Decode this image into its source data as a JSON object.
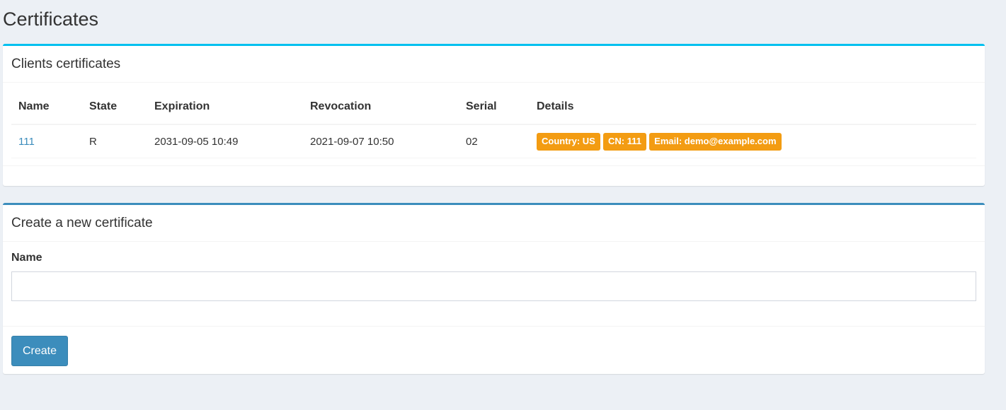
{
  "page": {
    "title": "Certificates"
  },
  "clients_box": {
    "title": "Clients certificates",
    "columns": [
      "Name",
      "State",
      "Expiration",
      "Revocation",
      "Serial",
      "Details"
    ],
    "rows": [
      {
        "name": "111",
        "state": "R",
        "expiration": "2031-09-05 10:49",
        "revocation": "2021-09-07 10:50",
        "serial": "02",
        "details": [
          "Country: US",
          "CN: 111",
          "Email: demo@example.com"
        ]
      }
    ]
  },
  "create_box": {
    "title": "Create a new certificate",
    "name_label": "Name",
    "name_value": "",
    "name_placeholder": "",
    "create_label": "Create"
  },
  "colors": {
    "info": "#00c0ef",
    "primary": "#3c8dbc",
    "warning": "#f39c12",
    "background": "#ecf0f5"
  }
}
